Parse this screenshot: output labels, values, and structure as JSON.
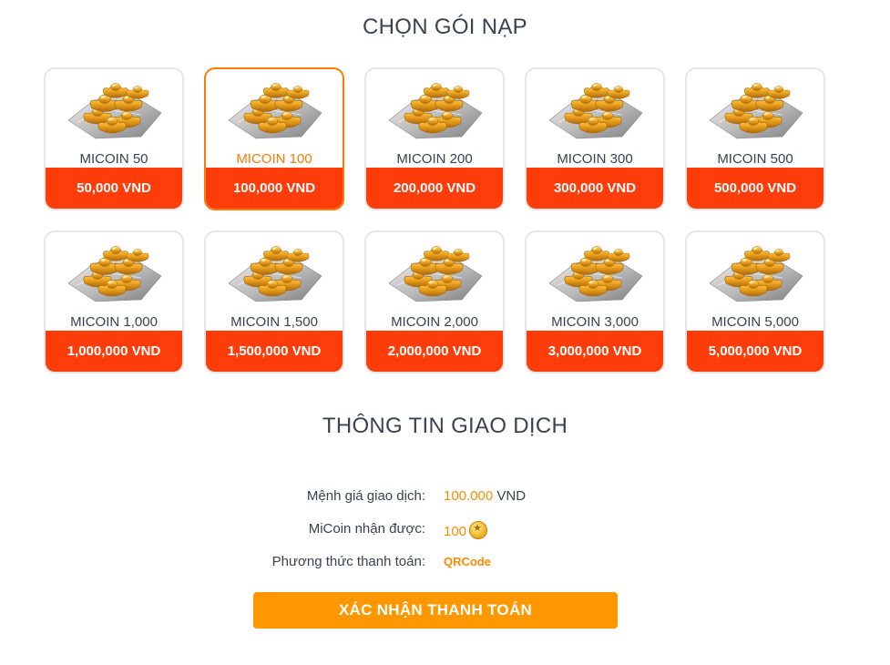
{
  "headings": {
    "packages": "CHỌN GÓI NẠP",
    "transaction": "THÔNG TIN GIAO DỊCH"
  },
  "packages": [
    {
      "name": "MICOIN 50",
      "price": "50,000 VND",
      "icon": "gold-ingot-icon",
      "selected": false
    },
    {
      "name": "MICOIN 100",
      "price": "100,000 VND",
      "icon": "gold-ingot-icon",
      "selected": true
    },
    {
      "name": "MICOIN 200",
      "price": "200,000 VND",
      "icon": "gold-ingot-icon",
      "selected": false
    },
    {
      "name": "MICOIN 300",
      "price": "300,000 VND",
      "icon": "gold-ingot-icon",
      "selected": false
    },
    {
      "name": "MICOIN 500",
      "price": "500,000 VND",
      "icon": "gold-ingot-icon",
      "selected": false
    },
    {
      "name": "MICOIN 1,000",
      "price": "1,000,000 VND",
      "icon": "gold-ingot-icon",
      "selected": false
    },
    {
      "name": "MICOIN 1,500",
      "price": "1,500,000 VND",
      "icon": "gold-ingot-icon",
      "selected": false
    },
    {
      "name": "MICOIN 2,000",
      "price": "2,000,000 VND",
      "icon": "gold-ingot-icon",
      "selected": false
    },
    {
      "name": "MICOIN 3,000",
      "price": "3,000,000 VND",
      "icon": "gold-ingot-icon",
      "selected": false
    },
    {
      "name": "MICOIN 5,000",
      "price": "5,000,000 VND",
      "icon": "gold-ingot-icon",
      "selected": false
    }
  ],
  "transaction": {
    "amount_label": "Mệnh giá giao dịch:",
    "amount_value": "100.000",
    "amount_currency": "VND",
    "micoin_label": "MiCoin nhận được:",
    "micoin_value": "100",
    "micoin_icon": "coin-icon",
    "method_label": "Phương thức thanh toán:",
    "method_value": "QRCode"
  },
  "confirm_label": "XÁC NHẬN THANH TOÁN",
  "colors": {
    "accent": "#ff9800",
    "price_bar": "#ff3d0b",
    "selected_border": "#ff7a00",
    "value_orange": "#ff8c00"
  }
}
